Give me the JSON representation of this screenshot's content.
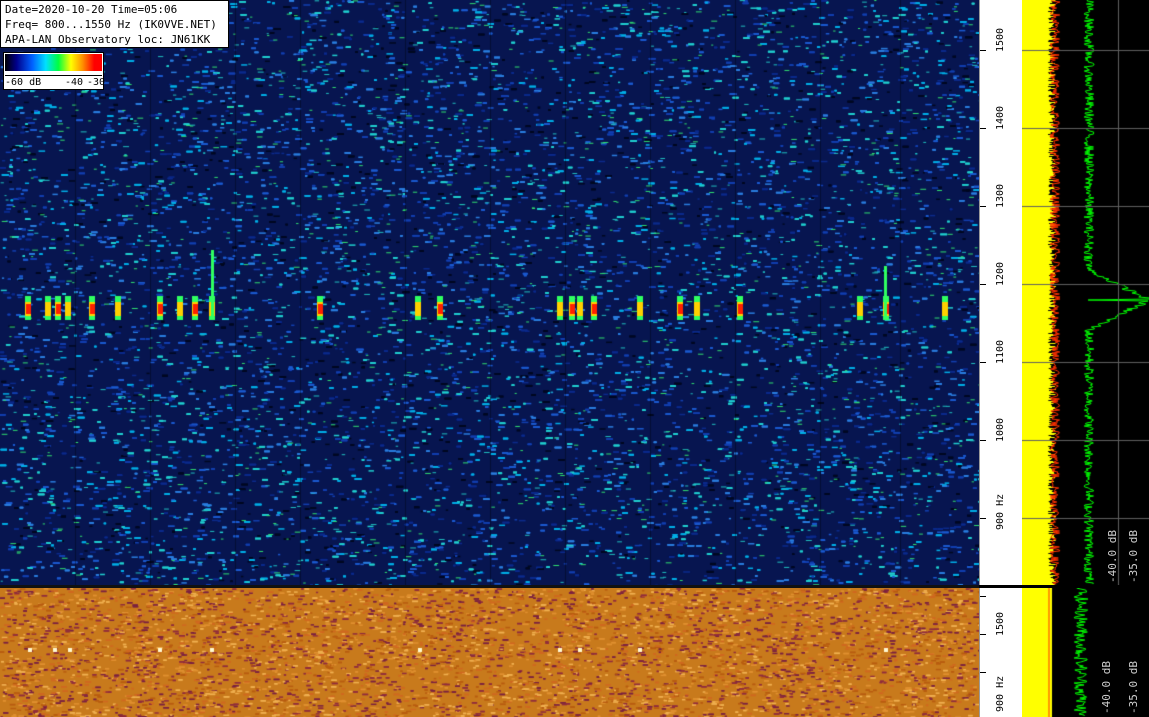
{
  "info": {
    "line1": "Date=2020-10-20 Time=05:06",
    "line2": "Freq= 800...1550 Hz (IK0VVE.NET)",
    "line3": "APA-LAN Observatory loc: JN61KK"
  },
  "scale": {
    "min": "-60 dB",
    "mid": "-40",
    "max": "-30"
  },
  "axis": {
    "labels": [
      "1500",
      "1400",
      "1300",
      "1200",
      "1100",
      "1000",
      "900 Hz"
    ],
    "lower_labels": [
      "1500",
      "900 Hz"
    ]
  },
  "spectrum": {
    "label_a": "-40.0 dB",
    "label_b": "-35.0 dB",
    "lower_label_a": "-40.0 dB",
    "lower_label_b": "-35.0 dB"
  },
  "colors": {
    "waterfall_bg": "#0a1a5a",
    "lower_bg": "#c8781a",
    "spectrum_yellow": "#ffff00",
    "spectrum_green": "#00ff00",
    "spectrum_red": "#ff0000"
  }
}
